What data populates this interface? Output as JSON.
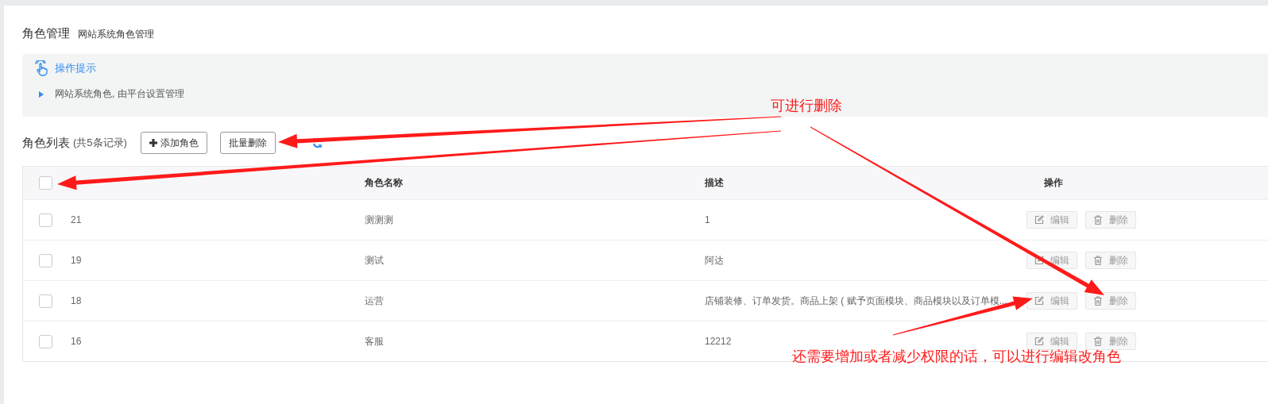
{
  "page_header": {
    "title": "角色管理",
    "subtitle": "网站系统角色管理"
  },
  "tips": {
    "title": "操作提示",
    "items": [
      "网站系统角色, 由平台设置管理"
    ]
  },
  "list_toolbar": {
    "title": "角色列表",
    "count": "(共5条记录)",
    "buttons": [
      {
        "kind": "add",
        "label": "添加角色"
      },
      {
        "kind": "batch_delete",
        "label": "批量删除"
      }
    ]
  },
  "table": {
    "select_all": {
      "checked": false
    },
    "columns": [
      "",
      "角色名称",
      "描述",
      "操作"
    ],
    "rows": [
      {
        "checked": false,
        "cells": [
          "21",
          "测测测",
          "1"
        ],
        "actions": [
          {
            "kind": "edit",
            "label": "编辑"
          },
          {
            "kind": "delete",
            "label": "删除"
          }
        ]
      },
      {
        "checked": false,
        "cells": [
          "19",
          "测试",
          "阿达"
        ],
        "actions": [
          {
            "kind": "edit",
            "label": "编辑"
          },
          {
            "kind": "delete",
            "label": "删除"
          }
        ]
      },
      {
        "checked": false,
        "cells": [
          "18",
          "运营",
          "店铺装修、订单发货。商品上架 ( 赋予页面模块、商品模块以及订单模..."
        ],
        "actions": [
          {
            "kind": "edit",
            "label": "编辑"
          },
          {
            "kind": "delete",
            "label": "删除"
          }
        ]
      },
      {
        "checked": false,
        "cells": [
          "16",
          "客服",
          "12212"
        ],
        "actions": [
          {
            "kind": "edit",
            "label": "编辑"
          },
          {
            "kind": "delete",
            "label": "删除"
          }
        ]
      }
    ]
  },
  "annotations": [
    {
      "text": "可进行删除"
    },
    {
      "text": "还需要增加或者减少权限的话，可以进行编辑改角色"
    }
  ]
}
